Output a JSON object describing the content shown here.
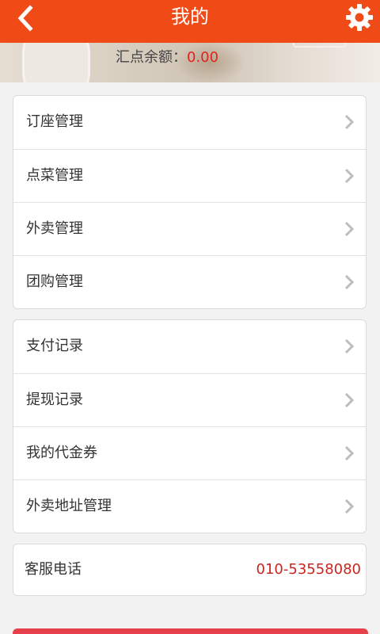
{
  "header": {
    "title": "我的",
    "back_icon": "chevron-left-icon",
    "settings_icon": "gear-icon",
    "color": "#f04b17"
  },
  "profile": {
    "balance_label": "汇点余额：",
    "balance_value": "0.00",
    "balance_color": "#e0231e"
  },
  "menu_groups": [
    {
      "items": [
        {
          "label": "订座管理"
        },
        {
          "label": "点菜管理"
        },
        {
          "label": "外卖管理"
        },
        {
          "label": "团购管理"
        }
      ]
    },
    {
      "items": [
        {
          "label": "支付记录"
        },
        {
          "label": "提现记录"
        },
        {
          "label": "我的代金券"
        },
        {
          "label": "外卖地址管理"
        }
      ]
    }
  ],
  "service": {
    "label": "客服电话",
    "phone": "010-53558080",
    "phone_color": "#c8261e"
  },
  "icons": {
    "row_arrow": "chevron-right-icon"
  }
}
